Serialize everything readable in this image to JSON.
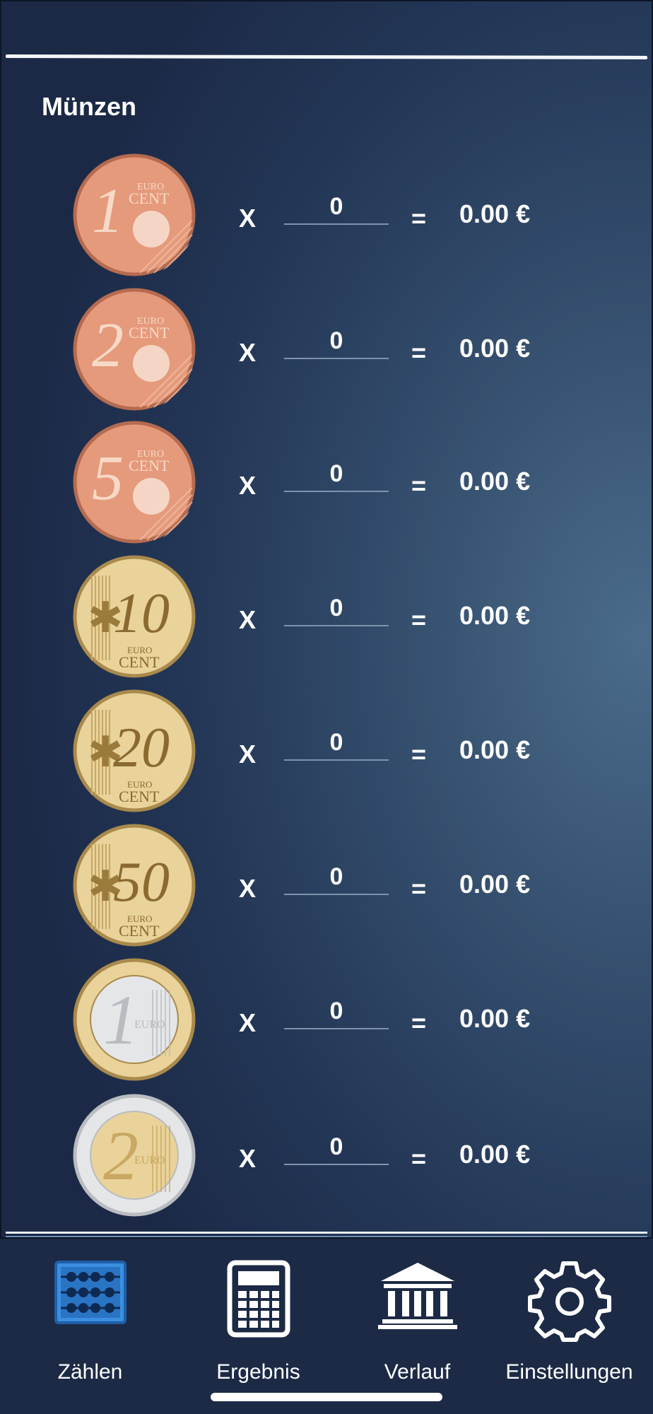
{
  "section_title": "Münzen",
  "multiply_symbol": "X",
  "equals_symbol": "=",
  "coins": [
    {
      "name": "1 cent",
      "numeral": "1",
      "unit": "CENT",
      "type": "copper",
      "quantity": "0",
      "amount": "0.00 €"
    },
    {
      "name": "2 cent",
      "numeral": "2",
      "unit": "CENT",
      "type": "copper",
      "quantity": "0",
      "amount": "0.00 €"
    },
    {
      "name": "5 cent",
      "numeral": "5",
      "unit": "CENT",
      "type": "copper",
      "quantity": "0",
      "amount": "0.00 €"
    },
    {
      "name": "10 cent",
      "numeral": "10",
      "unit": "CENT",
      "type": "gold",
      "quantity": "0",
      "amount": "0.00 €"
    },
    {
      "name": "20 cent",
      "numeral": "20",
      "unit": "CENT",
      "type": "gold",
      "quantity": "0",
      "amount": "0.00 €"
    },
    {
      "name": "50 cent",
      "numeral": "50",
      "unit": "CENT",
      "type": "gold",
      "quantity": "0",
      "amount": "0.00 €"
    },
    {
      "name": "1 euro",
      "numeral": "1",
      "unit": "EURO",
      "type": "bimetal-silver-center",
      "quantity": "0",
      "amount": "0.00 €"
    },
    {
      "name": "2 euro",
      "numeral": "2",
      "unit": "EURO",
      "type": "bimetal-gold-center",
      "quantity": "0",
      "amount": "0.00 €"
    }
  ],
  "tabs": [
    {
      "label": "Zählen",
      "icon": "abacus-icon",
      "active": true
    },
    {
      "label": "Ergebnis",
      "icon": "calculator-icon",
      "active": false
    },
    {
      "label": "Verlauf",
      "icon": "bank-icon",
      "active": false
    },
    {
      "label": "Einstellungen",
      "icon": "gear-icon",
      "active": false
    }
  ],
  "colors": {
    "copper": "#e59a7b",
    "copper_rim": "#b56b4f",
    "gold": "#e9d39a",
    "gold_rim": "#a98a4c",
    "silver": "#e4e6e8",
    "active_tab": "#3b8fe0"
  }
}
